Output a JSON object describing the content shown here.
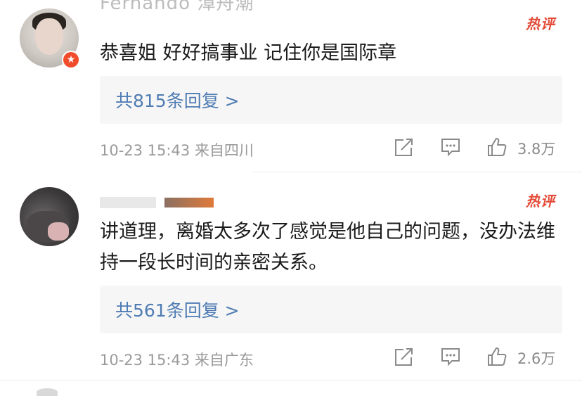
{
  "comments": [
    {
      "username": "Fernando 漳舟潮",
      "hot_label": "热评",
      "text": "恭喜姐 好好搞事业 记住你是国际章",
      "reply_label": "共815条回复 >",
      "time": "10-23 15:43",
      "location": "来自四川",
      "like_count": "3.8万"
    },
    {
      "username": "",
      "hot_label": "热评",
      "text": "讲道理，离婚太多次了感觉是他自己的问题，没办法维持一段长时间的亲密关系。",
      "reply_label": "共561条回复 >",
      "time": "10-23 15:43",
      "location": "来自广东",
      "like_count": "2.6万"
    }
  ],
  "icons": {
    "share": "share-icon",
    "reply": "comment-icon",
    "like": "thumbs-up-icon",
    "badge": "star-badge-icon"
  },
  "colors": {
    "accent_link": "#4f7cb3",
    "hot_red": "#e34a37",
    "badge_red": "#f04b2a"
  }
}
